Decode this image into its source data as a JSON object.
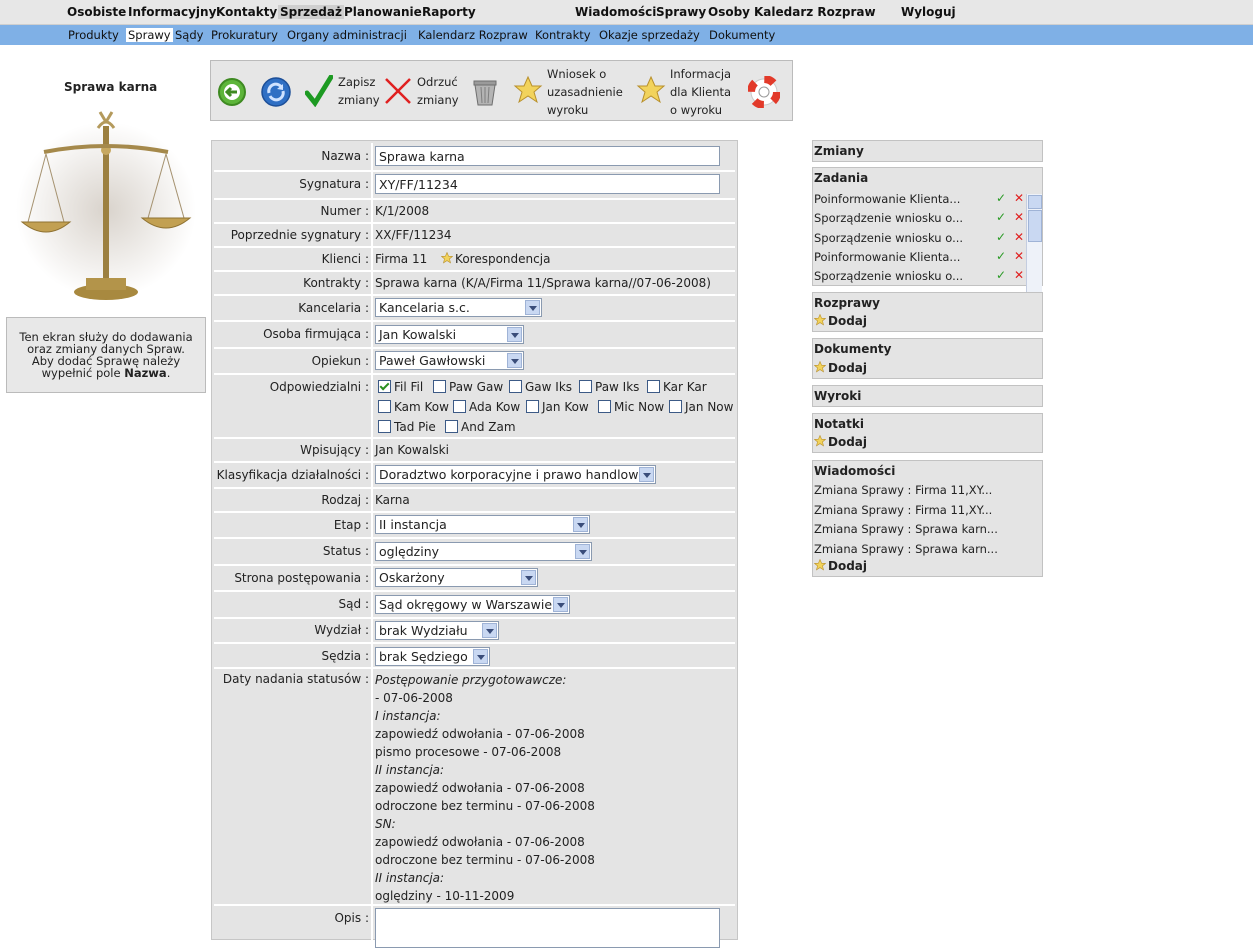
{
  "topnav": {
    "items": [
      "Osobiste",
      "Informacyjny",
      "Kontakty",
      "Sprzedaż",
      "Planowanie",
      "Raporty",
      "Wiadomości",
      "Sprawy",
      "Osoby",
      "Kaledarz Rozpraw",
      "Wyloguj"
    ]
  },
  "subnav": {
    "items": [
      "Produkty",
      "Sprawy",
      "Sądy",
      "Prokuratury",
      "Organy administracji",
      "Kalendarz Rozpraw",
      "Kontrakty",
      "Okazje sprzedaży",
      "Dokumenty"
    ]
  },
  "left": {
    "title": "Sprawa karna",
    "info_line1": "Ten ekran służy do dodawania",
    "info_line2": "oraz zmiany danych Spraw.",
    "info_line3": "Aby dodać Sprawę należy",
    "info_line4_pre": "wypełnić pole ",
    "info_line4_bold": "Nazwa",
    "info_line4_post": "."
  },
  "toolbar": {
    "save_l1": "Zapisz",
    "save_l2": "zmiany",
    "reject_l1": "Odrzuć",
    "reject_l2": "zmiany",
    "wniosek_l1": "Wniosek o",
    "wniosek_l2": "uzasadnienie",
    "wniosek_l3": "wyroku",
    "info_l1": "Informacja",
    "info_l2": "dla Klienta",
    "info_l3": "o wyroku"
  },
  "form": {
    "nazwa_label": "Nazwa :",
    "nazwa_value": "Sprawa karna",
    "sygnatura_label": "Sygnatura :",
    "sygnatura_value": "XY/FF/11234",
    "numer_label": "Numer :",
    "numer_value": "K/1/2008",
    "poprz_label": "Poprzednie sygnatury :",
    "poprz_value": "XX/FF/11234",
    "klienci_label": "Klienci :",
    "klienci_value": "Firma 11",
    "klienci_link": "Korespondencja",
    "kontrakty_label": "Kontrakty :",
    "kontrakty_value": "Sprawa karna (K/A/Firma 11/Sprawa karna//07-06-2008)",
    "kancelaria_label": "Kancelaria :",
    "kancelaria_value": "Kancelaria s.c.",
    "osoba_label": "Osoba firmująca :",
    "osoba_value": "Jan Kowalski",
    "opiekun_label": "Opiekun :",
    "opiekun_value": "Paweł Gawłowski",
    "odpow_label": "Odpowiedzialni :",
    "odpow": [
      "Fil Fil",
      "Paw Gaw",
      "Gaw Iks",
      "Paw Iks",
      "Kar Kar",
      "Kam Kow",
      "Ada Kow",
      "Jan Kow",
      "Mic Now",
      "Jan Now",
      "Tad Pie",
      "And Zam"
    ],
    "wpis_label": "Wpisujący :",
    "wpis_value": "Jan Kowalski",
    "klas_label": "Klasyfikacja działalności :",
    "klas_value": "Doradztwo korporacyjne i prawo handlowe",
    "rodzaj_label": "Rodzaj :",
    "rodzaj_value": "Karna",
    "etap_label": "Etap :",
    "etap_value": "II instancja",
    "status_label": "Status :",
    "status_value": "oględziny",
    "strona_label": "Strona postępowania :",
    "strona_value": "Oskarżony",
    "sad_label": "Sąd :",
    "sad_value": "Sąd okręgowy w Warszawie",
    "wydzial_label": "Wydział :",
    "wydzial_value": "brak Wydziału",
    "sedzia_label": "Sędzia :",
    "sedzia_value": "brak Sędziego",
    "daty_label": "Daty nadania statusów :",
    "daty": [
      {
        "t": "Postępowanie przygotowawcze:",
        "i": true
      },
      {
        "t": "- 07-06-2008",
        "i": false
      },
      {
        "t": "I instancja:",
        "i": true
      },
      {
        "t": "zapowiedź odwołania - 07-06-2008",
        "i": false
      },
      {
        "t": "pismo procesowe - 07-06-2008",
        "i": false
      },
      {
        "t": "II instancja:",
        "i": true
      },
      {
        "t": "zapowiedź odwołania - 07-06-2008",
        "i": false
      },
      {
        "t": "odroczone bez terminu - 07-06-2008",
        "i": false
      },
      {
        "t": "SN:",
        "i": true
      },
      {
        "t": "zapowiedź odwołania - 07-06-2008",
        "i": false
      },
      {
        "t": "odroczone bez terminu - 07-06-2008",
        "i": false
      },
      {
        "t": "II instancja:",
        "i": true
      },
      {
        "t": "oględziny - 10-11-2009",
        "i": false
      }
    ],
    "opis_label": "Opis :"
  },
  "right": {
    "zmiany_title": "Zmiany",
    "zadania_title": "Zadania",
    "zadania": [
      "Poinformowanie Klienta...",
      "Sporządzenie wniosku o...",
      "Sporządzenie wniosku o...",
      "Poinformowanie Klienta...",
      "Sporządzenie wniosku o..."
    ],
    "rozprawy_title": "Rozprawy",
    "dokumenty_title": "Dokumenty",
    "wyroki_title": "Wyroki",
    "notatki_title": "Notatki",
    "wiadomosci_title": "Wiadomości",
    "wiadomosci": [
      "Zmiana Sprawy : Firma 11,XY...",
      "Zmiana Sprawy : Firma 11,XY...",
      "Zmiana Sprawy : Sprawa karn...",
      "Zmiana Sprawy : Sprawa karn..."
    ],
    "add_label": "Dodaj"
  }
}
